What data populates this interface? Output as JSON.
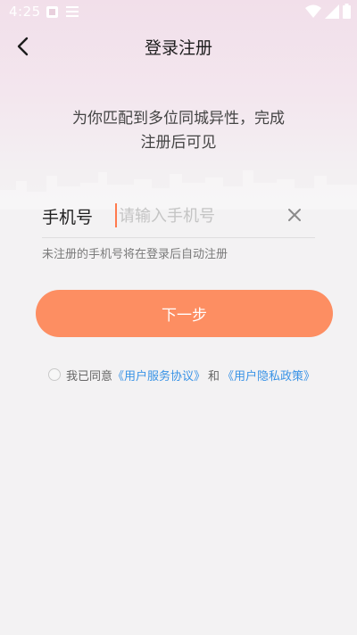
{
  "status_bar": {
    "time": "4:25",
    "icons": [
      "notification-icon",
      "menu-icon",
      "wifi-icon",
      "signal-icon",
      "battery-icon"
    ]
  },
  "header": {
    "back_icon": "chevron-left-icon",
    "title": "登录注册"
  },
  "subtitle": "为你匹配到多位同城异性，完成注册后可见",
  "phone_field": {
    "label": "手机号",
    "value": "",
    "placeholder": "请输入手机号",
    "clear_icon": "close-icon"
  },
  "hint": "未注册的手机号将在登录后自动注册",
  "next_button": {
    "label": "下一步"
  },
  "agreement": {
    "checked": false,
    "prefix": "我已同意",
    "user_agreement": "《用户服务协议》",
    "and": "和",
    "privacy_policy": "《用户隐私政策》"
  },
  "colors": {
    "accent": "#fd8e62",
    "caret": "#ff7a4d",
    "link": "#3a93e6",
    "background": "#f3f2f3"
  }
}
